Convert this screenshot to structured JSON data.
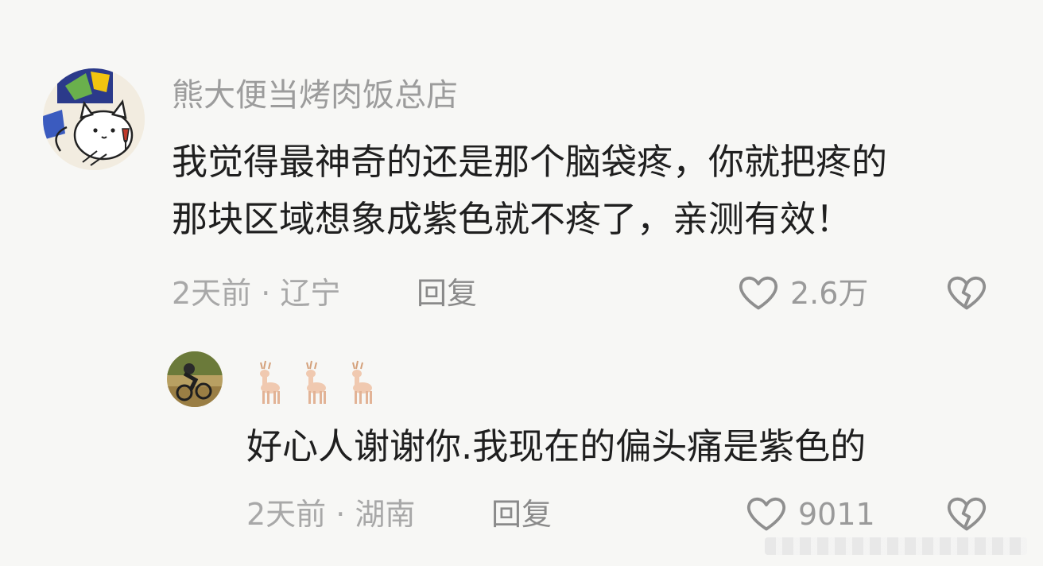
{
  "comments": [
    {
      "username": "熊大便当烤肉饭总店",
      "content": "我觉得最神奇的还是那个脑袋疼，你就把疼的\n那块区域想象成紫色就不疼了，亲测有效！",
      "meta": "2天前 · 辽宁",
      "reply_label": "回复",
      "likes": "2.6万",
      "avatar_icon": "cat-wine-icon",
      "like_icon": "heart-outline-icon",
      "dislike_icon": "broken-heart-icon"
    },
    {
      "username_icon": "deer-emoji-icon",
      "content": "好心人谢谢你.我现在的偏头痛是紫色的",
      "meta": "2天前 · 湖南",
      "reply_label": "回复",
      "likes": "9011",
      "avatar_icon": "cyclist-photo-icon",
      "like_icon": "heart-outline-icon",
      "dislike_icon": "broken-heart-icon"
    }
  ],
  "colors": {
    "background": "#f7f7f5",
    "username": "#9c9c9c",
    "content": "#1f1f1f",
    "meta": "#a8a8a8"
  }
}
